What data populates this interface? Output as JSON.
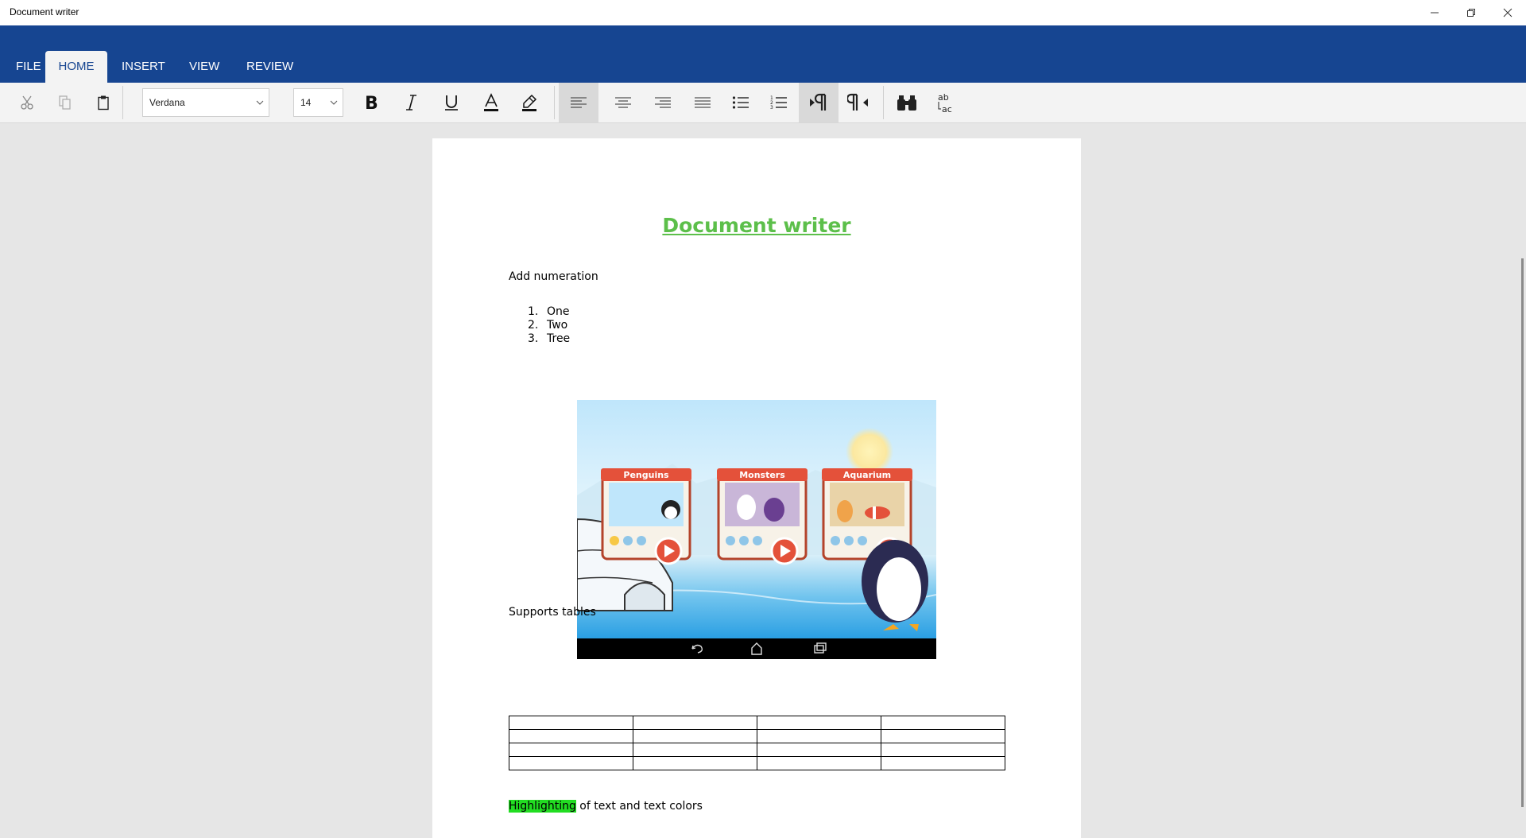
{
  "window": {
    "title": "Document writer"
  },
  "ribbon": {
    "tabs": [
      {
        "label": "FILE"
      },
      {
        "label": "HOME"
      },
      {
        "label": "INSERT"
      },
      {
        "label": "VIEW"
      },
      {
        "label": "REVIEW"
      }
    ],
    "active_tab": "HOME"
  },
  "toolbar": {
    "font_family": "Verdana",
    "font_size": "14",
    "active_alignment": "align-left",
    "active_direction": "left-to-right",
    "find_replace_label": "ab\n↳ac"
  },
  "document": {
    "title": "Document writer",
    "numeration_heading": "Add numeration",
    "list": [
      {
        "num": "1.",
        "text": "One"
      },
      {
        "num": "2.",
        "text": "Two"
      },
      {
        "num": "3.",
        "text": "Tree"
      }
    ],
    "image": {
      "cards": [
        {
          "label": "Penguins"
        },
        {
          "label": "Monsters"
        },
        {
          "label": "Aquarium"
        }
      ]
    },
    "tables_heading": "Supports tables",
    "table": {
      "rows": 4,
      "cols": 4
    },
    "highlight_text": "Highlighting",
    "highlight_rest": " of text and text colors"
  },
  "colors": {
    "ribbon": "#164591",
    "title": "#5cbf4a",
    "highlight": "#22dd22"
  }
}
